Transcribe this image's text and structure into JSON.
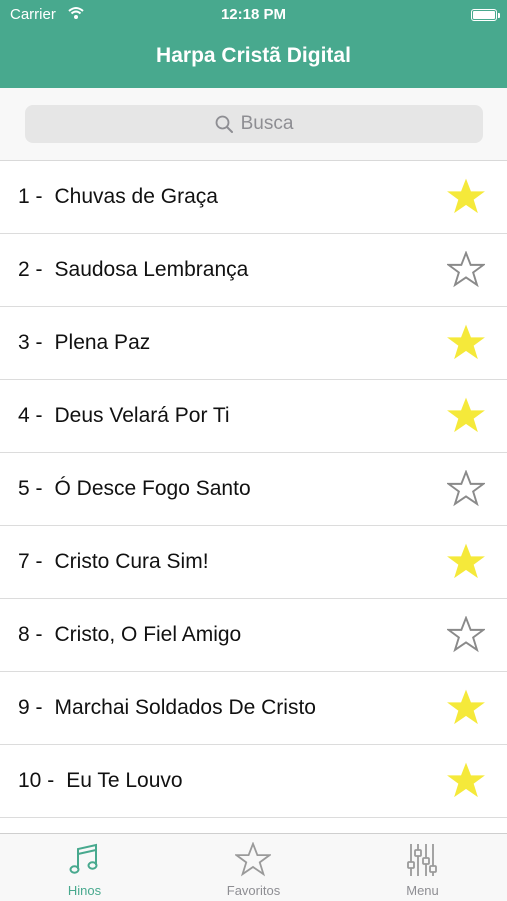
{
  "status_bar": {
    "carrier": "Carrier",
    "time": "12:18 PM"
  },
  "nav": {
    "title": "Harpa Cristã Digital"
  },
  "search": {
    "placeholder": "Busca"
  },
  "hymns": [
    {
      "number": "1 -",
      "title": "Chuvas de Graça",
      "favorite": true
    },
    {
      "number": "2 -",
      "title": "Saudosa Lembrança",
      "favorite": false
    },
    {
      "number": "3 -",
      "title": "Plena Paz",
      "favorite": true
    },
    {
      "number": "4 -",
      "title": "Deus Velará Por Ti",
      "favorite": true
    },
    {
      "number": "5 -",
      "title": "Ó Desce Fogo Santo",
      "favorite": false
    },
    {
      "number": "7 -",
      "title": "Cristo Cura Sim!",
      "favorite": true
    },
    {
      "number": "8 -",
      "title": "Cristo, O Fiel Amigo",
      "favorite": false
    },
    {
      "number": "9 -",
      "title": "Marchai Soldados De Cristo",
      "favorite": true
    },
    {
      "number": "10 -",
      "title": "Eu Te Louvo",
      "favorite": true
    }
  ],
  "tabs": [
    {
      "label": "Hinos",
      "icon": "music-note-icon",
      "active": true
    },
    {
      "label": "Favoritos",
      "icon": "star-icon",
      "active": false
    },
    {
      "label": "Menu",
      "icon": "sliders-icon",
      "active": false
    }
  ],
  "colors": {
    "accent": "#48a98e",
    "star_filled": "#f5e93a",
    "star_outline": "#8a8a8a"
  }
}
